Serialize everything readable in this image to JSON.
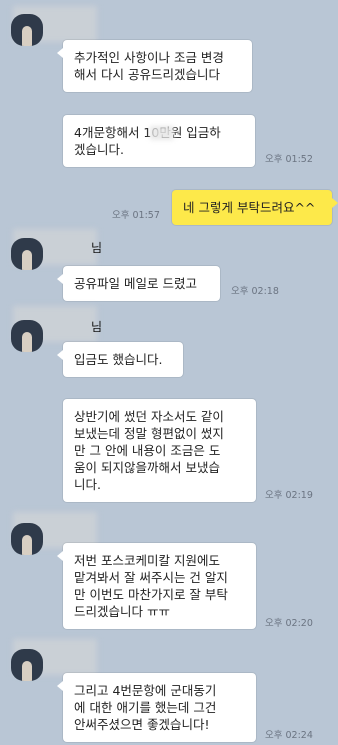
{
  "chat": {
    "messages": [
      {
        "id": "m1",
        "sender": "other",
        "text": "추가적인 사항이나 조금 변경\n해서 다시 공유드리겠습니다",
        "time": ""
      },
      {
        "id": "m2",
        "sender": "other",
        "text": "4개문항해서 10만원 입금하\n겠습니다.",
        "time": "오후 01:52"
      },
      {
        "id": "m3",
        "sender": "me",
        "text": "네 그렇게 부탁드려요^^",
        "time": "오후 01:57"
      },
      {
        "id": "m4",
        "sender": "other",
        "text": "공유파일 메일로 드렸고",
        "time": "오후 02:18"
      },
      {
        "id": "m5",
        "sender": "other",
        "text": "입금도 했습니다.",
        "time": ""
      },
      {
        "id": "m6",
        "sender": "other",
        "text": "상반기에 썼던 자소서도 같이\n보냈는데 정말 형편없이 썼지\n만 그 안에 내용이 조금은 도\n움이 되지않을까해서 보냈습\n니다.",
        "time": "오후 02:19"
      },
      {
        "id": "m7",
        "sender": "other",
        "text": "저번 포스코케미칼 지원에도\n맡겨봐서 잘 써주시는 건 알지\n만 이번도 마찬가지로 잘 부탁\n드리겠습니다 ㅠㅠ",
        "time": "오후 02:20"
      },
      {
        "id": "m8",
        "sender": "other",
        "text": "그리고 4번문항에 군대동기\n에 대한 애기를 했는데 그건\n안써주셨으면 좋겠습니다!",
        "time": "오후 02:24"
      }
    ],
    "name_fragment": "님"
  }
}
